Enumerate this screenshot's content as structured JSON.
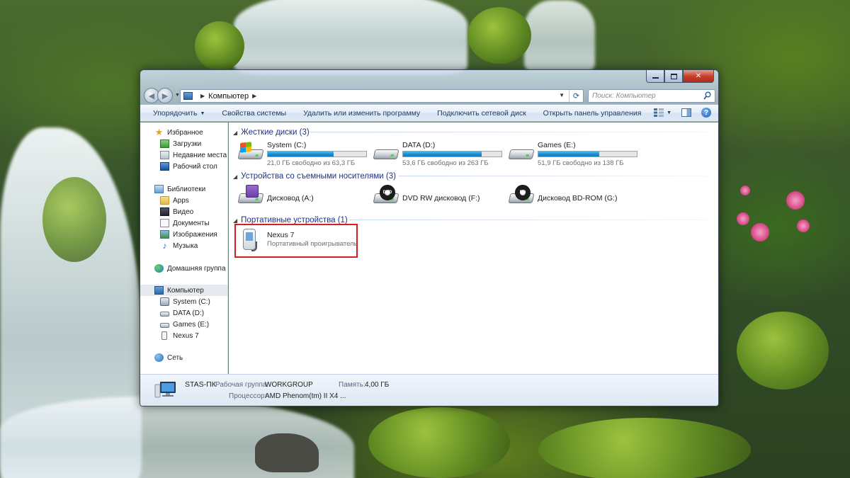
{
  "window": {
    "address": {
      "path": "Компьютер"
    },
    "search": {
      "placeholder": "Поиск: Компьютер"
    }
  },
  "commandbar": {
    "items": [
      {
        "label": "Упорядочить",
        "dropdown": true
      },
      {
        "label": "Свойства системы"
      },
      {
        "label": "Удалить или изменить программу"
      },
      {
        "label": "Подключить сетевой диск"
      },
      {
        "label": "Открыть панель управления"
      }
    ]
  },
  "navpane": {
    "favorites": {
      "label": "Избранное",
      "items": [
        "Загрузки",
        "Недавние места",
        "Рабочий стол"
      ]
    },
    "libraries": {
      "label": "Библиотеки",
      "items": [
        "Apps",
        "Видео",
        "Документы",
        "Изображения",
        "Музыка"
      ]
    },
    "homegroup": {
      "label": "Домашняя группа"
    },
    "computer": {
      "label": "Компьютер",
      "items": [
        "System (C:)",
        "DATA (D:)",
        "Games (E:)",
        "Nexus 7"
      ]
    },
    "network": {
      "label": "Сеть"
    }
  },
  "groups": {
    "hard_disks": {
      "label": "Жесткие диски (3)",
      "drives": [
        {
          "name": "System (C:)",
          "free_text": "21,0 ГБ свободно из 63,3 ГБ",
          "used_fraction": 0.67
        },
        {
          "name": "DATA (D:)",
          "free_text": "53,6 ГБ свободно из 263 ГБ",
          "used_fraction": 0.8
        },
        {
          "name": "Games (E:)",
          "free_text": "51,9 ГБ свободно из 138 ГБ",
          "used_fraction": 0.62
        }
      ]
    },
    "removable": {
      "label": "Устройства со съемными носителями (3)",
      "drives": [
        {
          "name": "Дисковод (A:)",
          "icon": "floppy-icon"
        },
        {
          "name": "DVD RW дисковод (F:)",
          "icon": "dvd-icon",
          "badge": "DVD"
        },
        {
          "name": "Дисковод BD-ROM (G:)",
          "icon": "bd-icon",
          "badge": "BD"
        }
      ]
    },
    "portable": {
      "label": "Портативные устройства (1)",
      "devices": [
        {
          "name": "Nexus 7",
          "type": "Портативный проигрыватель"
        }
      ]
    }
  },
  "details": {
    "computer_name": "STAS-ПК",
    "workgroup_label": "Рабочая группа:",
    "workgroup": "WORKGROUP",
    "memory_label": "Память:",
    "memory": "4,00 ГБ",
    "cpu_label": "Процессор:",
    "cpu": "AMD Phenom(tm) II X4 ..."
  }
}
